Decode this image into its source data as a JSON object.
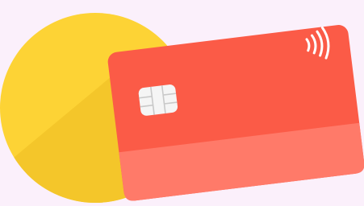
{
  "illustration": {
    "subject": "credit-card",
    "colors": {
      "background": "#fbf0fb",
      "circle_light": "#fdd335",
      "circle_dark": "#f4c62a",
      "card_top": "#fb5b47",
      "card_bottom_stripe": "#ff7a69",
      "chip": "#f5f5f5",
      "chip_lines": "#c9c9c9",
      "contactless": "#ffffff"
    },
    "icons": {
      "chip": "chip-icon",
      "contactless": "contactless-icon"
    }
  }
}
